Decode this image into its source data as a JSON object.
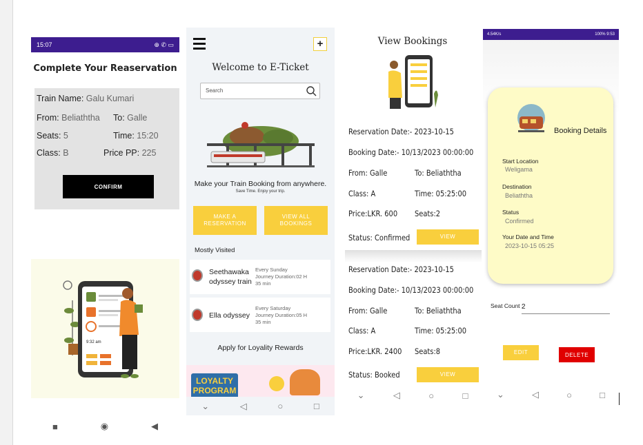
{
  "screen1": {
    "status_time": "15:07",
    "status_right": "⊕ ✆ ▭",
    "title": "Complete Your Reaservation",
    "train_label": "Train Name:",
    "train_value": "Galu Kumari",
    "from_label": "From:",
    "from_value": "Beliaththa",
    "to_label": "To:",
    "to_value": "Galle",
    "seats_label": "Seats:",
    "seats_value": "5",
    "time_label": "Time:",
    "time_value": "15:20",
    "class_label": "Class:",
    "class_value": "B",
    "price_label": "Price PP:",
    "price_value": "225",
    "confirm": "CONFIRM",
    "phone_time": "9:32 am"
  },
  "screen2": {
    "title": "Welcome to E-Ticket",
    "search_placeholder": "Search",
    "tagline": "Make your Train Booking from anywhere.",
    "subtag": "Save Time. Enjoy your trip.",
    "make_btn_1": "MAKE A",
    "make_btn_2": "RESERVATION",
    "view_btn_1": "VIEW ALL",
    "view_btn_2": "BOOKINGS",
    "mostly_visited": "Mostly Visited",
    "items": [
      {
        "name1": "Seethawaka",
        "name2": "odyssey train",
        "sched": "Every Sunday",
        "journey": "Journey Duration:02 H",
        "min": "35 min"
      },
      {
        "name1": "Ella odyssey",
        "name2": "",
        "sched": "Every Saturday",
        "journey": "Journey Duration:05 H",
        "min": "35 min"
      }
    ],
    "loyalty": "Apply for Loyality Rewards",
    "promo_1": "LOYALTY",
    "promo_2": "PROGRAM"
  },
  "screen3": {
    "title": "View Bookings",
    "bookings": [
      {
        "res": "Reservation Date:- 2023-10-15",
        "book": "Booking Date:- 10/13/2023 00:00:00",
        "from": "From: Galle",
        "to": "To: Beliaththa",
        "cls": "Class: A",
        "time": "Time: 05:25:00",
        "price": "Price:LKR. 600",
        "seats": "Seats:2",
        "status": "Status: Confirmed",
        "view": "VIEW"
      },
      {
        "res": "Reservation Date:- 2023-10-15",
        "book": "Booking Date:- 10/13/2023 00:00:00",
        "from": "From: Galle",
        "to": "To: Beliaththa",
        "cls": "Class: A",
        "time": "Time: 05:25:00",
        "price": "Price:LKR. 2400",
        "seats": "Seats:8",
        "status": "Status: Booked",
        "view": "VIEW"
      }
    ]
  },
  "screen4": {
    "status_left": "4.54K/s",
    "status_right": "100% 9:53",
    "title": "Booking Details",
    "start_label": "Start Location",
    "start_value": "Weligama",
    "dest_label": "Destination",
    "dest_value": "Beliaththa",
    "status_label": "Status",
    "status_value": "Confirmed",
    "date_label": "Your Date and Time",
    "date_value": "2023-10-15 05:25",
    "seat_label": "Seat Count :",
    "seat_value": "2",
    "edit": "EDIT",
    "delete": "DELETE"
  },
  "colors": {
    "yellow": "#f9cf3d",
    "purple": "#3d1d8f",
    "cream": "#fefbc7",
    "red": "#e00000"
  }
}
